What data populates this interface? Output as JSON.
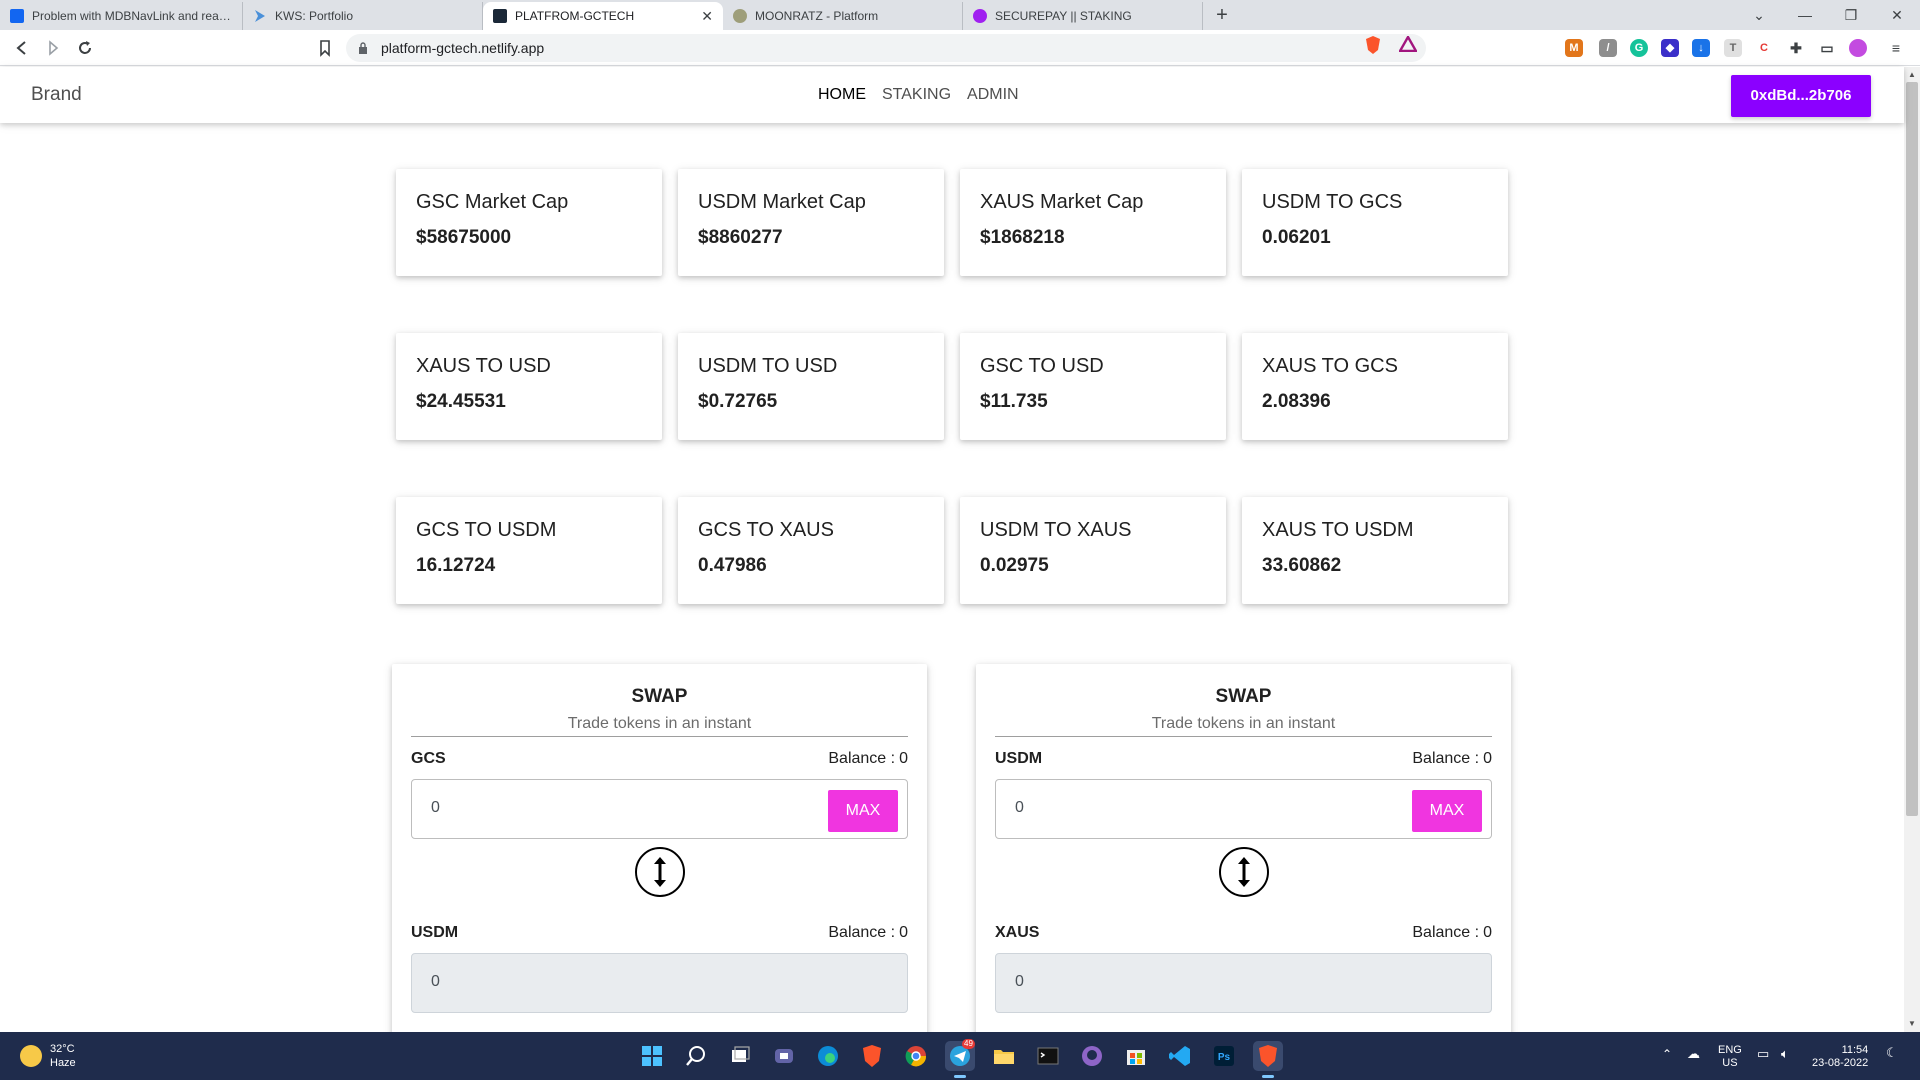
{
  "browser": {
    "tabs": [
      {
        "label": "Problem with MDBNavLink and react-",
        "active": false
      },
      {
        "label": "KWS: Portfolio",
        "active": false
      },
      {
        "label": "PLATFROM-GCTECH",
        "active": true
      },
      {
        "label": "MOONRATZ - Platform",
        "active": false
      },
      {
        "label": "SECUREPAY || STAKING",
        "active": false
      }
    ],
    "new_tab_symbol": "+",
    "close_symbol": "✕",
    "url": "platform-gctech.netlify.app"
  },
  "navbar": {
    "brand": "Brand",
    "links": [
      {
        "label": "HOME",
        "active": true
      },
      {
        "label": "STAKING",
        "active": false
      },
      {
        "label": "ADMIN",
        "active": false
      }
    ],
    "wallet_button": "0xdBd...2b706"
  },
  "stats": [
    {
      "title": "GSC Market Cap",
      "value": "$58675000"
    },
    {
      "title": "USDM Market Cap",
      "value": "$8860277"
    },
    {
      "title": "XAUS Market Cap",
      "value": "$1868218"
    },
    {
      "title": "USDM TO GCS",
      "value": "0.06201"
    },
    {
      "title": "XAUS TO USD",
      "value": "$24.45531"
    },
    {
      "title": "USDM TO USD",
      "value": "$0.72765"
    },
    {
      "title": "GSC TO USD",
      "value": "$11.735"
    },
    {
      "title": "XAUS TO GCS",
      "value": "2.08396"
    },
    {
      "title": "GCS TO USDM",
      "value": "16.12724"
    },
    {
      "title": "GCS TO XAUS",
      "value": "0.47986"
    },
    {
      "title": "USDM TO XAUS",
      "value": "0.02975"
    },
    {
      "title": "XAUS TO USDM",
      "value": "33.60862"
    }
  ],
  "swaps": [
    {
      "title": "SWAP",
      "subtitle": "Trade tokens in an instant",
      "from_token": "GCS",
      "from_balance_label": "Balance :",
      "from_balance": "0",
      "from_value": "0",
      "max_label": "MAX",
      "to_token": "USDM",
      "to_balance_label": "Balance :",
      "to_balance": "0",
      "to_value": "0"
    },
    {
      "title": "SWAP",
      "subtitle": "Trade tokens in an instant",
      "from_token": "USDM",
      "from_balance_label": "Balance :",
      "from_balance": "0",
      "from_value": "0",
      "max_label": "MAX",
      "to_token": "XAUS",
      "to_balance_label": "Balance :",
      "to_balance": "0",
      "to_value": "0"
    }
  ],
  "taskbar": {
    "weather_temp": "32°C",
    "weather_desc": "Haze",
    "lang_top": "ENG",
    "lang_bottom": "US",
    "time": "11:54",
    "date": "23-08-2022",
    "telegram_badge": "49"
  },
  "colors": {
    "wallet_button": "#8b00ff",
    "max_button": "#f035e0",
    "taskbar": "#1f2c4c"
  }
}
